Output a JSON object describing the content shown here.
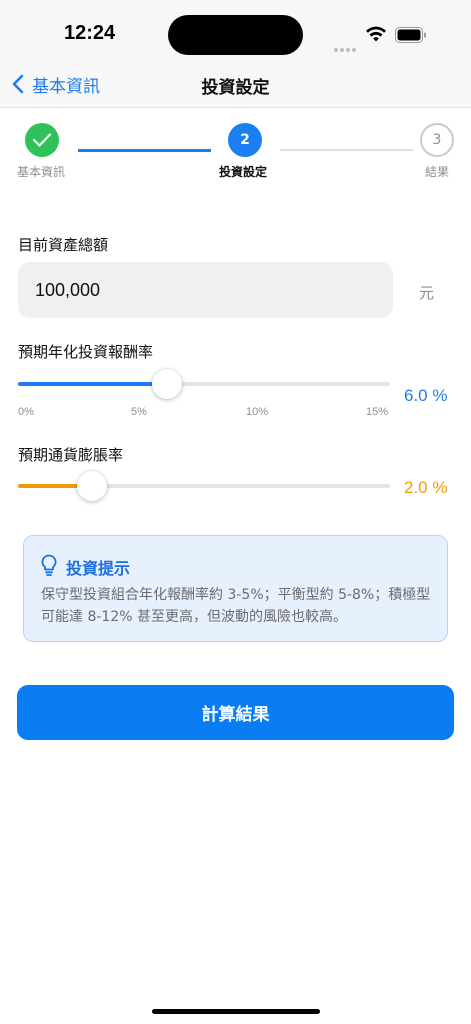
{
  "status_bar": {
    "time": "12:24"
  },
  "nav": {
    "back_label": "基本資訊",
    "title": "投資設定"
  },
  "stepper": {
    "steps": [
      {
        "number": "",
        "label": "基本資訊",
        "state": "done"
      },
      {
        "number": "2",
        "label": "投資設定",
        "state": "active"
      },
      {
        "number": "3",
        "label": "結果",
        "state": "pending"
      }
    ]
  },
  "form": {
    "asset": {
      "label": "目前資產總額",
      "value": "100,000",
      "unit": "元"
    },
    "return_rate": {
      "label": "預期年化投資報酬率",
      "value": 6.0,
      "value_text": "6.0 %",
      "min": 0,
      "max": 15,
      "ticks": [
        "0%",
        "5%",
        "10%",
        "15%"
      ],
      "color": "#1d7cf2"
    },
    "inflation_rate": {
      "label": "預期通貨膨脹率",
      "value": 2.0,
      "value_text": "2.0 %",
      "min": 0,
      "max": 10,
      "color": "#f39a0c"
    }
  },
  "tip": {
    "icon": "lightbulb-icon",
    "title": "投資提示",
    "body": "保守型投資組合年化報酬率約 3-5%；平衡型約 5-8%；積極型可能達 8-12% 甚至更高，但波動的風險也較高。"
  },
  "actions": {
    "calculate_label": "計算結果"
  },
  "colors": {
    "accent": "#1a7ff0",
    "success": "#30c25a",
    "warning": "#f39a0c",
    "button": "#0a7df5"
  }
}
